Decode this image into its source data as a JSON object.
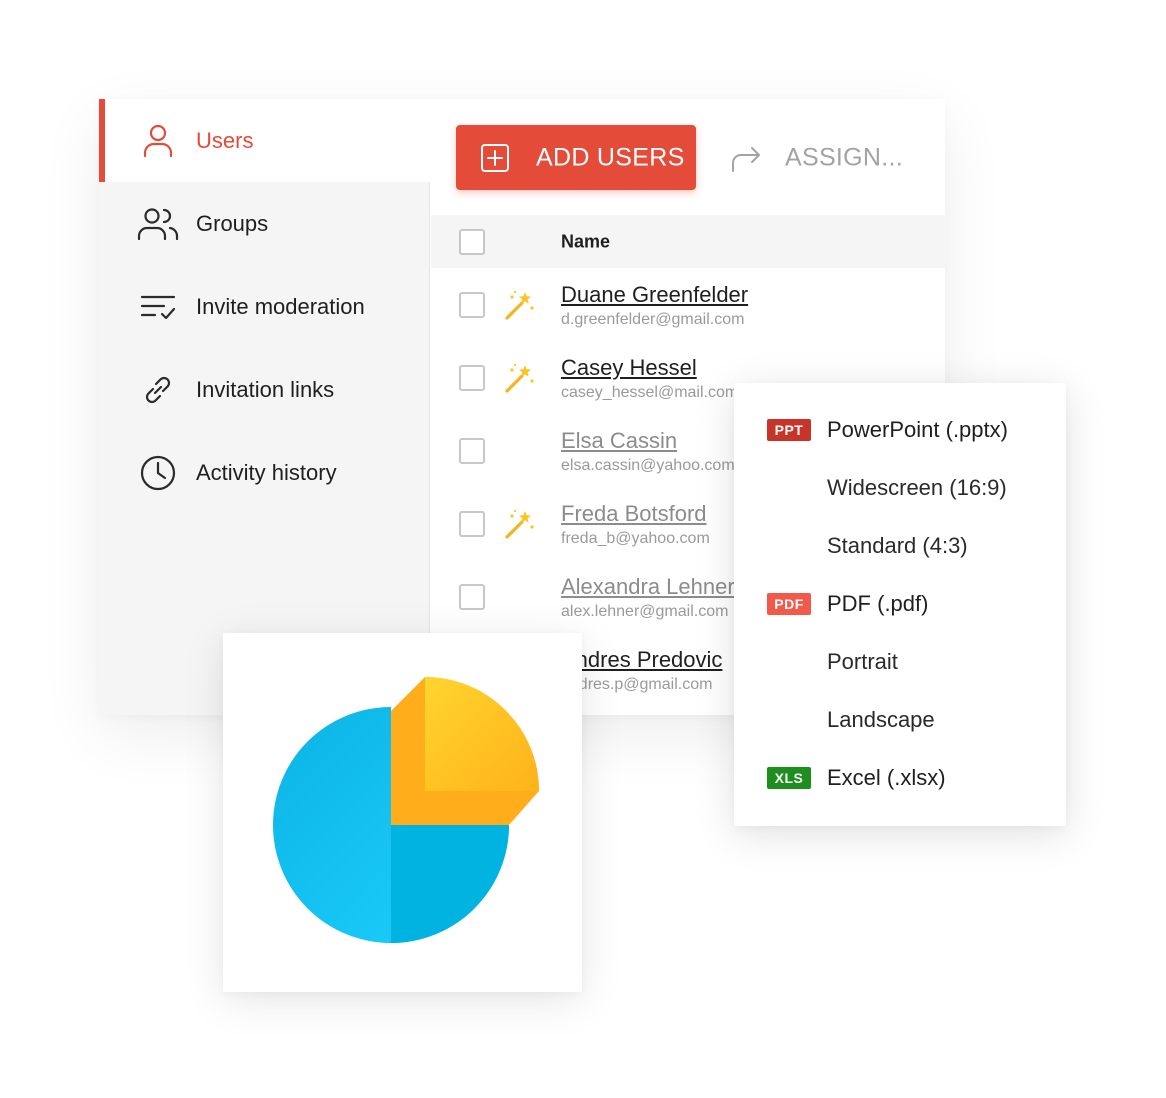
{
  "sidebar": {
    "items": [
      {
        "label": "Users",
        "icon": "user-icon",
        "active": true
      },
      {
        "label": "Groups",
        "icon": "users-group-icon",
        "active": false
      },
      {
        "label": "Invite moderation",
        "icon": "checklist-icon",
        "active": false
      },
      {
        "label": "Invitation links",
        "icon": "link-icon",
        "active": false
      },
      {
        "label": "Activity history",
        "icon": "clock-icon",
        "active": false
      }
    ]
  },
  "toolbar": {
    "add_users_label": "ADD USERS",
    "assign_label": "ASSIGN..."
  },
  "table": {
    "column_name": "Name",
    "rows": [
      {
        "name": "Duane Greenfelder",
        "email": "d.greenfelder@gmail.com",
        "wand": true,
        "muted": false
      },
      {
        "name": "Casey Hessel",
        "email": "casey_hessel@mail.com",
        "wand": true,
        "muted": false
      },
      {
        "name": "Elsa Cassin",
        "email": "elsa.cassin@yahoo.com",
        "wand": false,
        "muted": true
      },
      {
        "name": "Freda Botsford",
        "email": "freda_b@yahoo.com",
        "wand": true,
        "muted": true
      },
      {
        "name": "Alexandra Lehner",
        "email": "alex.lehner@gmail.com",
        "wand": false,
        "muted": true
      },
      {
        "name": "Andres Predovic",
        "email": "andres.p@gmail.com",
        "wand": false,
        "muted": false
      }
    ]
  },
  "export_menu": {
    "items": [
      {
        "badge": "PPT",
        "label": "PowerPoint (.pptx)"
      },
      {
        "badge": "",
        "label": "Widescreen (16:9)"
      },
      {
        "badge": "",
        "label": "Standard (4:3)"
      },
      {
        "badge": "PDF",
        "label": "PDF (.pdf)"
      },
      {
        "badge": "",
        "label": "Portrait"
      },
      {
        "badge": "",
        "label": "Landscape"
      },
      {
        "badge": "XLS",
        "label": "Excel (.xlsx)"
      }
    ]
  },
  "colors": {
    "accent": "#e44b38",
    "ppt_badge": "#c7352a",
    "pdf_badge": "#f15a4a",
    "xls_badge": "#1e8e1e",
    "pie_blue": "#18c3ee",
    "pie_yellow": "#ffc21f"
  },
  "chart_data": {
    "type": "pie",
    "slices": [
      {
        "value": 75,
        "color": "#18c3ee"
      },
      {
        "value": 25,
        "color": "#ffc21f",
        "exploded": true
      }
    ]
  }
}
